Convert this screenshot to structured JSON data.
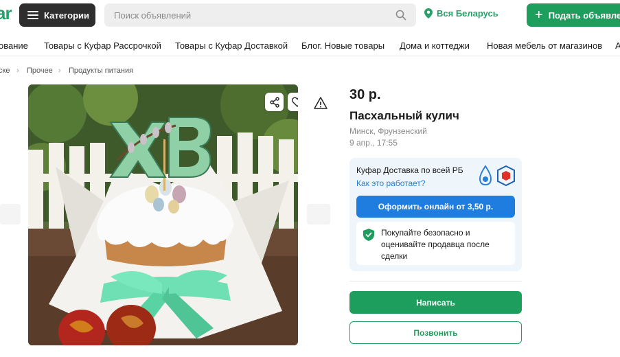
{
  "header": {
    "logo_text": "ar",
    "categories_label": "Категории",
    "search_placeholder": "Поиск объявлений",
    "region_label": "Вся Беларусь",
    "post_label": "Подать объявление"
  },
  "nav": {
    "items": [
      "ование",
      "Товары с Куфар Рассрочкой",
      "Товары с Куфар Доставкой",
      "Блог. Новые товары",
      "Дома и коттеджи",
      "Новая мебель от магазинов",
      "А"
    ]
  },
  "breadcrumb": {
    "items": [
      "ске",
      "Прочее",
      "Продукты питания"
    ]
  },
  "listing": {
    "price": "30 р.",
    "title": "Пасхальный кулич",
    "location": "Минск, Фрунзенский",
    "date": "9 апр., 17:55"
  },
  "delivery": {
    "title": "Куфар Доставка по всей РБ",
    "link": "Как это работает?",
    "order_button": "Оформить онлайн от 3,50 р.",
    "safe_text": "Покупайте безопасно и оценивайте продавца после сделки"
  },
  "actions": {
    "write": "Написать",
    "call": "Позвонить"
  },
  "colors": {
    "brand_green": "#1e9e5c",
    "link_blue": "#2a7fd4",
    "button_blue": "#1f7de0",
    "delivery_bg": "#eef5fb"
  }
}
